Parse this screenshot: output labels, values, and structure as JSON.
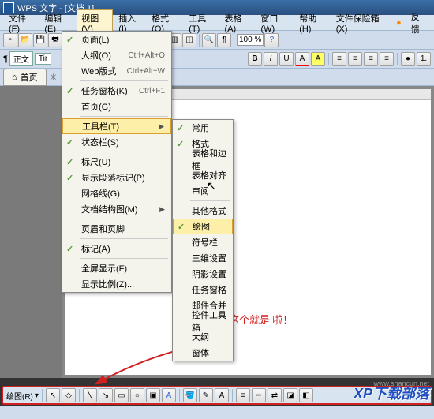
{
  "title": "WPS 文字 - [文档 1]",
  "menubar": [
    "文件(F)",
    "编辑(E)",
    "视图(V)",
    "插入(I)",
    "格式(O)",
    "工具(T)",
    "表格(A)",
    "窗口(W)",
    "帮助(H)",
    "文件保险箱(X)"
  ],
  "menubar_active_index": 2,
  "feedback_label": "反馈",
  "zoom": "100 %",
  "style_selector": "正文",
  "font_selector": "Tir",
  "tab_label": "首页",
  "view_menu": [
    {
      "label": "页面(L)",
      "check": true
    },
    {
      "label": "大纲(O)",
      "shortcut": "Ctrl+Alt+O"
    },
    {
      "label": "Web版式",
      "shortcut": "Ctrl+Alt+W"
    },
    {
      "sep": true
    },
    {
      "label": "任务窗格(K)",
      "shortcut": "Ctrl+F1",
      "check": true
    },
    {
      "label": "首页(G)"
    },
    {
      "sep": true
    },
    {
      "label": "工具栏(T)",
      "arrow": true,
      "hl": true
    },
    {
      "label": "状态栏(S)",
      "check": true
    },
    {
      "sep": true
    },
    {
      "label": "标尺(U)",
      "check": true
    },
    {
      "label": "显示段落标记(P)",
      "check": true
    },
    {
      "label": "网格线(G)"
    },
    {
      "label": "文档结构图(M)",
      "arrow": true
    },
    {
      "sep": true
    },
    {
      "label": "页眉和页脚"
    },
    {
      "sep": true
    },
    {
      "label": "标记(A)",
      "check": true
    },
    {
      "sep": true
    },
    {
      "label": "全屏显示(F)"
    },
    {
      "label": "显示比例(Z)..."
    }
  ],
  "toolbars_submenu": [
    {
      "label": "常用",
      "check": true
    },
    {
      "label": "格式",
      "check": true
    },
    {
      "label": "表格和边框"
    },
    {
      "label": "表格对齐"
    },
    {
      "label": "审阅"
    },
    {
      "sep": true
    },
    {
      "label": "其他格式"
    },
    {
      "label": "绘图",
      "check": true,
      "hl": true
    },
    {
      "label": "符号栏"
    },
    {
      "label": "三维设置"
    },
    {
      "label": "阴影设置"
    },
    {
      "label": "任务窗格"
    },
    {
      "label": "邮件合并"
    },
    {
      "label": "控件工具箱"
    },
    {
      "label": "大纲"
    },
    {
      "label": "窗体"
    }
  ],
  "annotation_text": "这个就是\n啦！",
  "bottom_toolbar_label": "绘图(R)",
  "watermark": "XP下载部落",
  "watermark_url": "www.shancun.net"
}
